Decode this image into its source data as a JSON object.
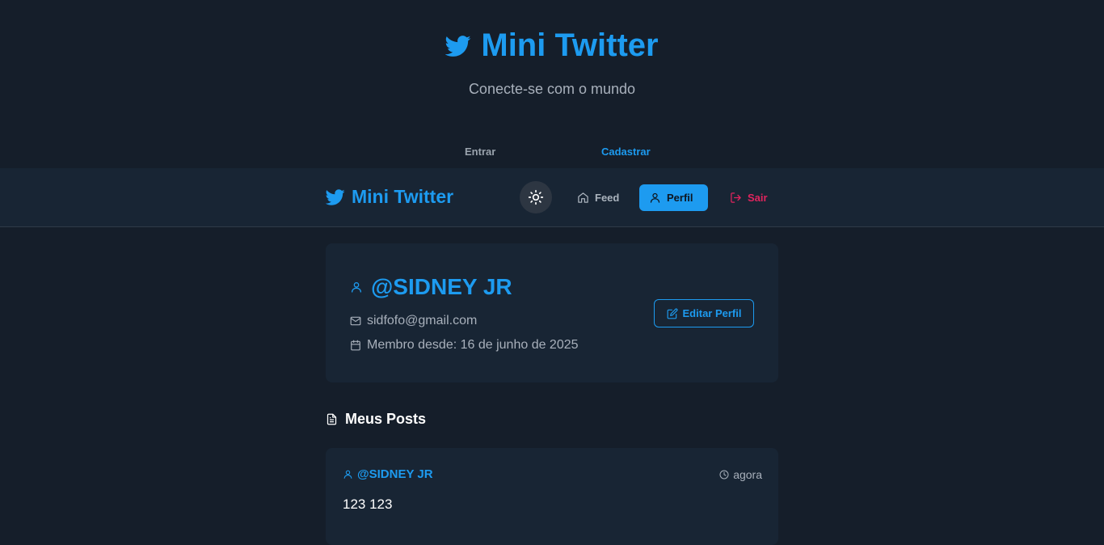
{
  "hero": {
    "title": "Mini Twitter",
    "subtitle": "Conecte-se com o mundo",
    "tabs": {
      "login": "Entrar",
      "register": "Cadastrar"
    }
  },
  "navbar": {
    "brand": "Mini Twitter",
    "theme_icon": "sun-icon",
    "links": {
      "feed": "Feed",
      "profile": "Perfil",
      "logout": "Sair"
    }
  },
  "profile": {
    "username": "@SIDNEY JR",
    "email": "sidfofo@gmail.com",
    "member_since": "Membro desde: 16 de junho de 2025",
    "edit_label": "Editar Perfil"
  },
  "posts_section": {
    "title": "Meus Posts",
    "posts": [
      {
        "author": "@SIDNEY JR",
        "time": "agora",
        "text": "123 123"
      }
    ]
  },
  "colors": {
    "background": "#151e2a",
    "card": "#182534",
    "accent": "#1d9bf0",
    "danger": "#e0245e"
  }
}
